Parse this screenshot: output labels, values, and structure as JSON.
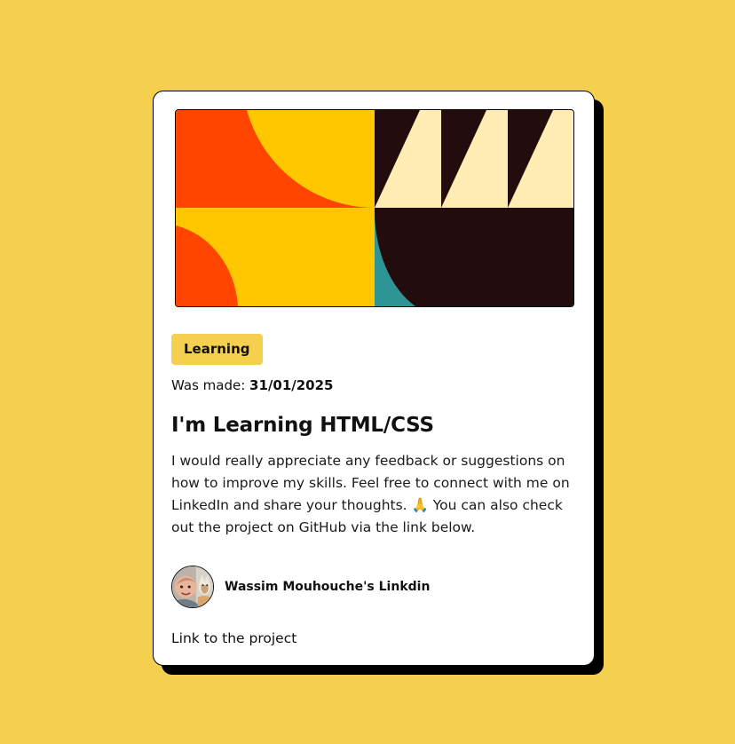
{
  "card": {
    "tag": "Learning",
    "published_label": "Was made: ",
    "published_date": "31/01/2025",
    "title": "I'm Learning HTML/CSS",
    "description": "I would really appreciate any feedback or suggestions on how to improve my skills. Feel free to connect with me on LinkedIn and share your thoughts. 🙏 You can also check out the project on GitHub via the link below.",
    "author_link_label": "Wassim Mouhouche's Linkdin",
    "project_link_label": "Link to the project"
  },
  "colors": {
    "background": "#F4D04E",
    "card": "#FFFFFF",
    "shadow": "#000000",
    "tag_bg": "#F4D04E",
    "hero_orange": "#FF4500",
    "hero_yellow": "#FFC700",
    "hero_dark": "#230C0D",
    "hero_cream": "#FFEDB3",
    "hero_teal": "#2E9494"
  },
  "icons": {
    "hero": "abstract-geometric-illustration",
    "avatar": "author-avatar-photo"
  }
}
